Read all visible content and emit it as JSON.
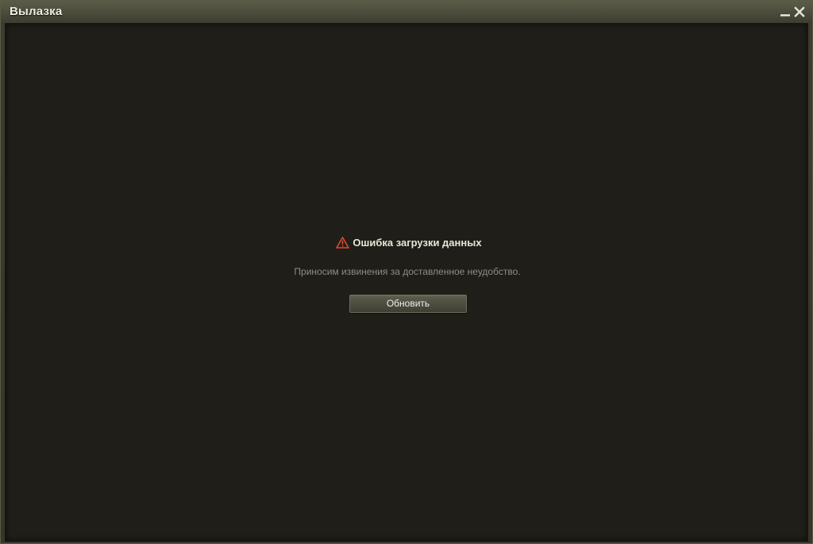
{
  "window": {
    "title": "Вылазка"
  },
  "controls": {
    "minimize_icon": "minimize-icon",
    "close_icon": "close-icon"
  },
  "error": {
    "icon": "warning-icon",
    "heading": "Ошибка загрузки данных",
    "message": "Приносим извинения за доставленное неудобство.",
    "refresh_label": "Обновить"
  },
  "colors": {
    "warning": "#e8472a",
    "heading_text": "#e9e6d6",
    "message_text": "#8f8d82",
    "content_bg": "#1f1e19"
  }
}
